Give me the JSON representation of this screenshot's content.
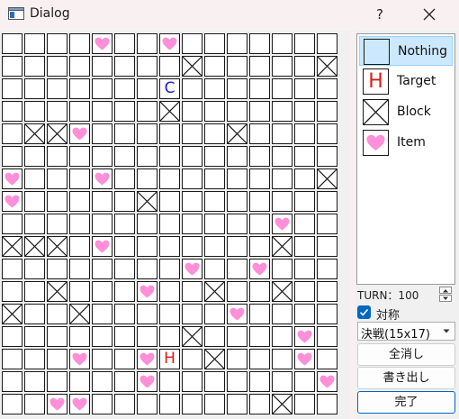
{
  "window": {
    "title": "Dialog",
    "help_glyph": "?",
    "icons": [
      "app-window-icon",
      "close-icon"
    ]
  },
  "colors": {
    "heart": "#ff8fd8",
    "target_letter": "#e01818",
    "start_letter": "#1c1ccf",
    "selection": "#cce8ff",
    "accent": "#0067c0"
  },
  "board": {
    "rows": 17,
    "cols": 15,
    "legend": ". empty, X block, * item, H target, C start marker",
    "map": [
      "....*..*.......",
      "........X.....X",
      ".......C.......",
      ".......X.......",
      ".XX*......X....",
      "...............",
      "*...*.........X",
      "*.....X........",
      "............*..",
      "XXX.*.......X..",
      "........*..*...",
      "..X...*..X..X..",
      "X..X......*....",
      "........X....*.",
      "...*..*H.X...*.",
      "......*.......*",
      "..**........X.."
    ],
    "target_letter": "H",
    "start_letter": "C"
  },
  "palette": {
    "items": [
      {
        "label": "Nothing",
        "icon": "empty-cell-icon",
        "selected": true
      },
      {
        "label": "Target",
        "icon": "target-h-icon",
        "letter": "H"
      },
      {
        "label": "Block",
        "icon": "block-x-icon"
      },
      {
        "label": "Item",
        "icon": "heart-icon"
      }
    ]
  },
  "turn": {
    "label": "TURN：100",
    "value": 100
  },
  "symmetric": {
    "label": "対称",
    "checked": true
  },
  "mode_select": {
    "value": "決戦(15x17)"
  },
  "buttons": {
    "clear": "全消し",
    "export": "書き出し",
    "done": "完了"
  }
}
